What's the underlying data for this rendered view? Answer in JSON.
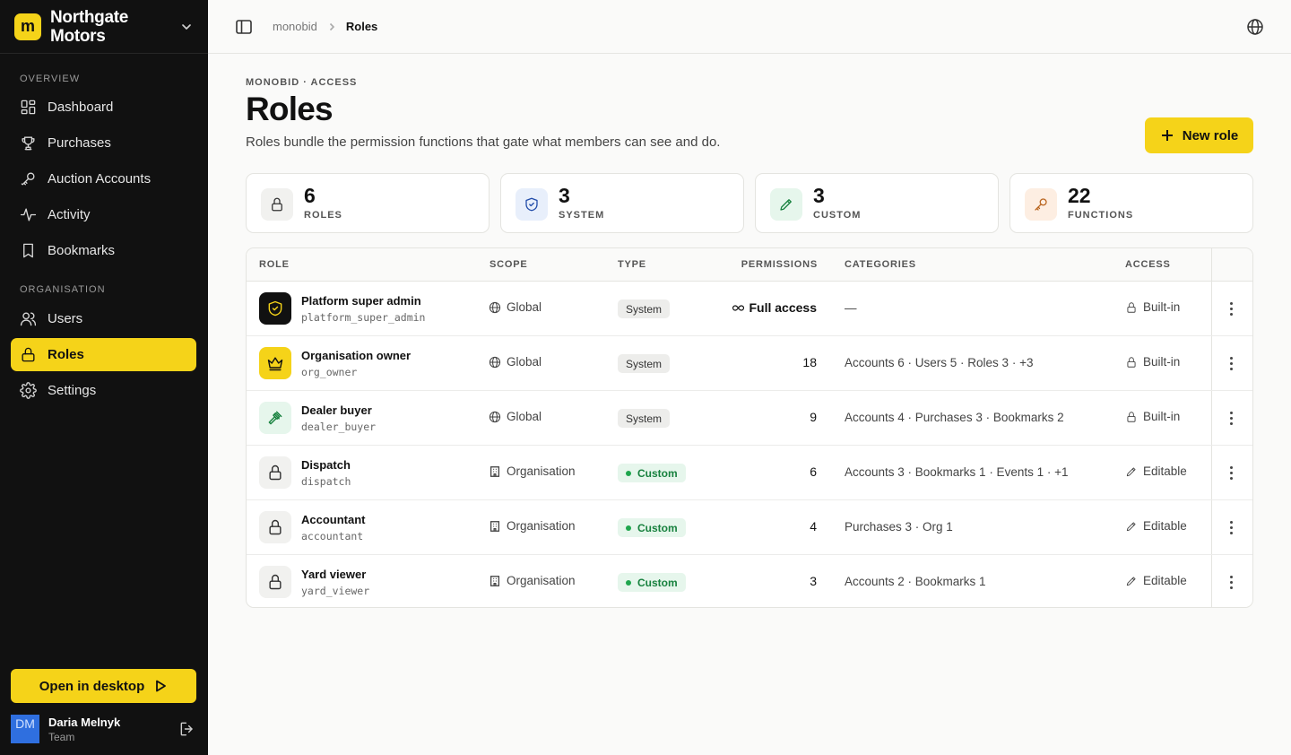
{
  "brand": {
    "logo_letter": "m",
    "name_line1": "Northgate",
    "name_line2": "Motors"
  },
  "nav": {
    "overview_label": "OVERVIEW",
    "organisation_label": "ORGANISATION",
    "items": [
      {
        "label": "Dashboard",
        "icon": "dashboard-icon"
      },
      {
        "label": "Purchases",
        "icon": "trophy-icon"
      },
      {
        "label": "Auction Accounts",
        "icon": "key-icon"
      },
      {
        "label": "Activity",
        "icon": "activity-icon"
      },
      {
        "label": "Bookmarks",
        "icon": "bookmark-icon"
      },
      {
        "label": "Users",
        "icon": "users-icon"
      },
      {
        "label": "Roles",
        "icon": "lock-icon",
        "active": true
      },
      {
        "label": "Settings",
        "icon": "gear-icon"
      }
    ]
  },
  "sidebar_footer": {
    "open_desktop_label": "Open in desktop",
    "user": {
      "initials": "DM",
      "name": "Daria Melnyk",
      "team": "Team"
    }
  },
  "breadcrumb": {
    "root": "monobid",
    "current": "Roles"
  },
  "page": {
    "eyebrow": "MONOBID · ACCESS",
    "title": "Roles",
    "subtitle": "Roles bundle the permission functions that gate what members can see and do.",
    "new_role_label": "New role"
  },
  "stats": [
    {
      "value": "6",
      "label": "ROLES",
      "icon": "lock-icon"
    },
    {
      "value": "3",
      "label": "SYSTEM",
      "icon": "shield-icon"
    },
    {
      "value": "3",
      "label": "CUSTOM",
      "icon": "pencil-icon"
    },
    {
      "value": "22",
      "label": "FUNCTIONS",
      "icon": "key-icon"
    }
  ],
  "table": {
    "headers": {
      "role": "ROLE",
      "scope": "SCOPE",
      "type": "TYPE",
      "permissions": "PERMISSIONS",
      "categories": "CATEGORIES",
      "access": "ACCESS"
    },
    "rows": [
      {
        "name": "Platform super admin",
        "code": "platform_super_admin",
        "scope": "Global",
        "type": "System",
        "permissions": "Full access",
        "categories": "—",
        "access": "Built-in"
      },
      {
        "name": "Organisation owner",
        "code": "org_owner",
        "scope": "Global",
        "type": "System",
        "permissions": "18",
        "categories": "Accounts 6 · Users 5 · Roles 3 · +3",
        "access": "Built-in"
      },
      {
        "name": "Dealer buyer",
        "code": "dealer_buyer",
        "scope": "Global",
        "type": "System",
        "permissions": "9",
        "categories": "Accounts 4 · Purchases 3 · Bookmarks 2",
        "access": "Built-in"
      },
      {
        "name": "Dispatch",
        "code": "dispatch",
        "scope": "Organisation",
        "type": "Custom",
        "permissions": "6",
        "categories": "Accounts 3 · Bookmarks 1 · Events 1 · +1",
        "access": "Editable"
      },
      {
        "name": "Accountant",
        "code": "accountant",
        "scope": "Organisation",
        "type": "Custom",
        "permissions": "4",
        "categories": "Purchases 3 · Org 1",
        "access": "Editable"
      },
      {
        "name": "Yard viewer",
        "code": "yard_viewer",
        "scope": "Organisation",
        "type": "Custom",
        "permissions": "3",
        "categories": "Accounts 2 · Bookmarks 1",
        "access": "Editable"
      }
    ]
  },
  "colors": {
    "accent": "#f5d319",
    "sidebar_bg": "#111111",
    "custom_green": "#17813e"
  }
}
